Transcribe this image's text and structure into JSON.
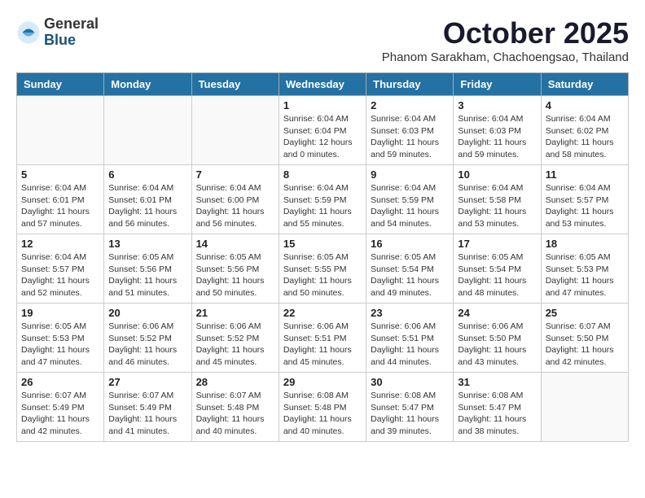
{
  "logo": {
    "general": "General",
    "blue": "Blue"
  },
  "title": "October 2025",
  "subtitle": "Phanom Sarakham, Chachoengsao, Thailand",
  "days_of_week": [
    "Sunday",
    "Monday",
    "Tuesday",
    "Wednesday",
    "Thursday",
    "Friday",
    "Saturday"
  ],
  "weeks": [
    [
      {
        "day": "",
        "info": ""
      },
      {
        "day": "",
        "info": ""
      },
      {
        "day": "",
        "info": ""
      },
      {
        "day": "1",
        "info": "Sunrise: 6:04 AM\nSunset: 6:04 PM\nDaylight: 12 hours\nand 0 minutes."
      },
      {
        "day": "2",
        "info": "Sunrise: 6:04 AM\nSunset: 6:03 PM\nDaylight: 11 hours\nand 59 minutes."
      },
      {
        "day": "3",
        "info": "Sunrise: 6:04 AM\nSunset: 6:03 PM\nDaylight: 11 hours\nand 59 minutes."
      },
      {
        "day": "4",
        "info": "Sunrise: 6:04 AM\nSunset: 6:02 PM\nDaylight: 11 hours\nand 58 minutes."
      }
    ],
    [
      {
        "day": "5",
        "info": "Sunrise: 6:04 AM\nSunset: 6:01 PM\nDaylight: 11 hours\nand 57 minutes."
      },
      {
        "day": "6",
        "info": "Sunrise: 6:04 AM\nSunset: 6:01 PM\nDaylight: 11 hours\nand 56 minutes."
      },
      {
        "day": "7",
        "info": "Sunrise: 6:04 AM\nSunset: 6:00 PM\nDaylight: 11 hours\nand 56 minutes."
      },
      {
        "day": "8",
        "info": "Sunrise: 6:04 AM\nSunset: 5:59 PM\nDaylight: 11 hours\nand 55 minutes."
      },
      {
        "day": "9",
        "info": "Sunrise: 6:04 AM\nSunset: 5:59 PM\nDaylight: 11 hours\nand 54 minutes."
      },
      {
        "day": "10",
        "info": "Sunrise: 6:04 AM\nSunset: 5:58 PM\nDaylight: 11 hours\nand 53 minutes."
      },
      {
        "day": "11",
        "info": "Sunrise: 6:04 AM\nSunset: 5:57 PM\nDaylight: 11 hours\nand 53 minutes."
      }
    ],
    [
      {
        "day": "12",
        "info": "Sunrise: 6:04 AM\nSunset: 5:57 PM\nDaylight: 11 hours\nand 52 minutes."
      },
      {
        "day": "13",
        "info": "Sunrise: 6:05 AM\nSunset: 5:56 PM\nDaylight: 11 hours\nand 51 minutes."
      },
      {
        "day": "14",
        "info": "Sunrise: 6:05 AM\nSunset: 5:56 PM\nDaylight: 11 hours\nand 50 minutes."
      },
      {
        "day": "15",
        "info": "Sunrise: 6:05 AM\nSunset: 5:55 PM\nDaylight: 11 hours\nand 50 minutes."
      },
      {
        "day": "16",
        "info": "Sunrise: 6:05 AM\nSunset: 5:54 PM\nDaylight: 11 hours\nand 49 minutes."
      },
      {
        "day": "17",
        "info": "Sunrise: 6:05 AM\nSunset: 5:54 PM\nDaylight: 11 hours\nand 48 minutes."
      },
      {
        "day": "18",
        "info": "Sunrise: 6:05 AM\nSunset: 5:53 PM\nDaylight: 11 hours\nand 47 minutes."
      }
    ],
    [
      {
        "day": "19",
        "info": "Sunrise: 6:05 AM\nSunset: 5:53 PM\nDaylight: 11 hours\nand 47 minutes."
      },
      {
        "day": "20",
        "info": "Sunrise: 6:06 AM\nSunset: 5:52 PM\nDaylight: 11 hours\nand 46 minutes."
      },
      {
        "day": "21",
        "info": "Sunrise: 6:06 AM\nSunset: 5:52 PM\nDaylight: 11 hours\nand 45 minutes."
      },
      {
        "day": "22",
        "info": "Sunrise: 6:06 AM\nSunset: 5:51 PM\nDaylight: 11 hours\nand 45 minutes."
      },
      {
        "day": "23",
        "info": "Sunrise: 6:06 AM\nSunset: 5:51 PM\nDaylight: 11 hours\nand 44 minutes."
      },
      {
        "day": "24",
        "info": "Sunrise: 6:06 AM\nSunset: 5:50 PM\nDaylight: 11 hours\nand 43 minutes."
      },
      {
        "day": "25",
        "info": "Sunrise: 6:07 AM\nSunset: 5:50 PM\nDaylight: 11 hours\nand 42 minutes."
      }
    ],
    [
      {
        "day": "26",
        "info": "Sunrise: 6:07 AM\nSunset: 5:49 PM\nDaylight: 11 hours\nand 42 minutes."
      },
      {
        "day": "27",
        "info": "Sunrise: 6:07 AM\nSunset: 5:49 PM\nDaylight: 11 hours\nand 41 minutes."
      },
      {
        "day": "28",
        "info": "Sunrise: 6:07 AM\nSunset: 5:48 PM\nDaylight: 11 hours\nand 40 minutes."
      },
      {
        "day": "29",
        "info": "Sunrise: 6:08 AM\nSunset: 5:48 PM\nDaylight: 11 hours\nand 40 minutes."
      },
      {
        "day": "30",
        "info": "Sunrise: 6:08 AM\nSunset: 5:47 PM\nDaylight: 11 hours\nand 39 minutes."
      },
      {
        "day": "31",
        "info": "Sunrise: 6:08 AM\nSunset: 5:47 PM\nDaylight: 11 hours\nand 38 minutes."
      },
      {
        "day": "",
        "info": ""
      }
    ]
  ]
}
